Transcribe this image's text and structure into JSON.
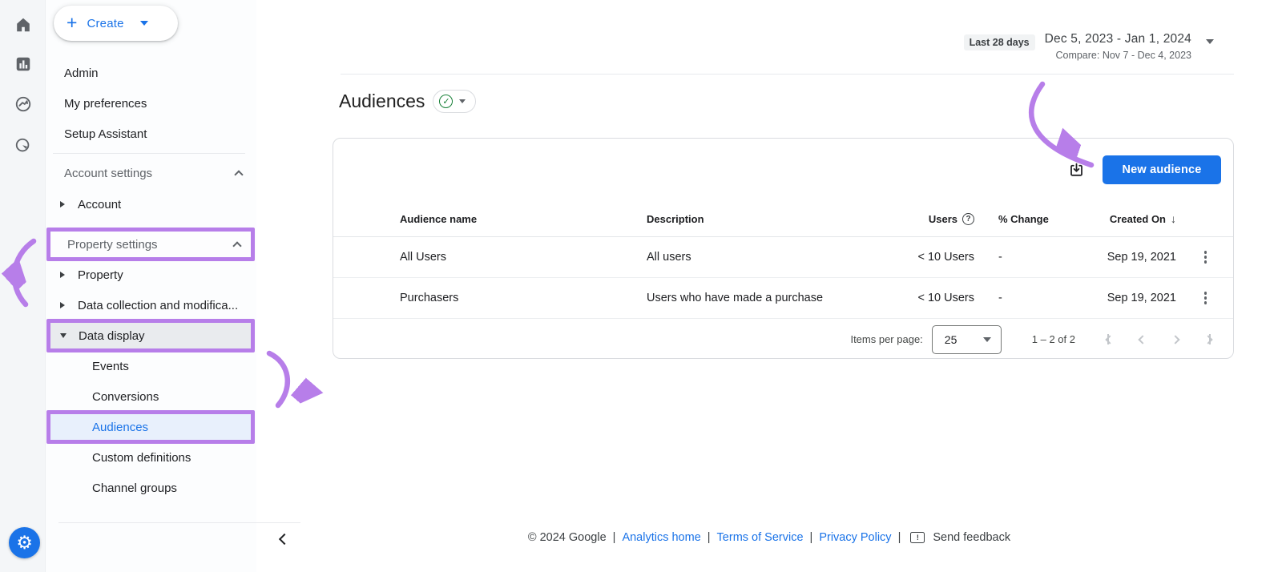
{
  "colors": {
    "accent": "#1a73e8",
    "annotation": "#b77ee9",
    "success": "#188038",
    "button_blue": "#1a73e8"
  },
  "rail": {
    "icons": [
      "home-icon",
      "reports-icon",
      "explore-icon",
      "advertising-icon"
    ],
    "admin_gear": "admin-settings"
  },
  "nav": {
    "create_label": "Create",
    "top": [
      "Admin",
      "My preferences",
      "Setup Assistant"
    ],
    "account_settings": "Account settings",
    "account": "Account",
    "property_settings": "Property settings",
    "property": "Property",
    "data_collection": "Data collection and modifica...",
    "data_display": "Data display",
    "events": "Events",
    "conversions": "Conversions",
    "audiences": "Audiences",
    "custom_definitions": "Custom definitions",
    "channel_groups": "Channel groups"
  },
  "header": {
    "range_label": "Last 28 days",
    "range_value": "Dec 5, 2023 - Jan 1, 2024",
    "compare": "Compare: Nov 7 - Dec 4, 2023"
  },
  "page": {
    "title": "Audiences"
  },
  "card": {
    "new_audience_label": "New audience"
  },
  "table": {
    "headers": [
      "Audience name",
      "Description",
      "Users",
      "% Change",
      "Created On"
    ],
    "rows": [
      {
        "name": "All Users",
        "description": "All users",
        "users": "< 10 Users",
        "change": "-",
        "created": "Sep 19, 2021"
      },
      {
        "name": "Purchasers",
        "description": "Users who have made a purchase",
        "users": "< 10 Users",
        "change": "-",
        "created": "Sep 19, 2021"
      }
    ]
  },
  "pagination": {
    "items_per_page_label": "Items per page:",
    "page_size": "25",
    "range_text": "1 – 2 of 2"
  },
  "footer": {
    "copyright": "© 2024 Google",
    "separator": "|",
    "links": [
      "Analytics home",
      "Terms of Service",
      "Privacy Policy"
    ],
    "send_feedback": "Send feedback"
  },
  "glyphs": {
    "check": "✓",
    "question": "?",
    "sort_down": "↓",
    "plus": "+",
    "gear": "⚙",
    "exclaim": "!"
  }
}
